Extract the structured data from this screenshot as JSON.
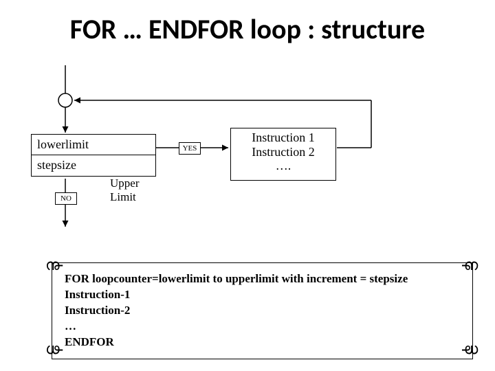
{
  "title": "FOR … ENDFOR loop : structure",
  "flow": {
    "lowerlimit": "lowerlimit",
    "stepsize": "stepsize",
    "no": "NO",
    "upper_limit": "Upper\nLimit",
    "yes": "YES",
    "instr1": "Instruction 1",
    "instr2": "Instruction 2",
    "instr3": "…."
  },
  "code": {
    "l1": "FOR loopcounter=lowerlimit to upperlimit with increment = stepsize",
    "l2": "Instruction-1",
    "l3": "Instruction-2",
    "l4": "…",
    "l5": "ENDFOR"
  }
}
